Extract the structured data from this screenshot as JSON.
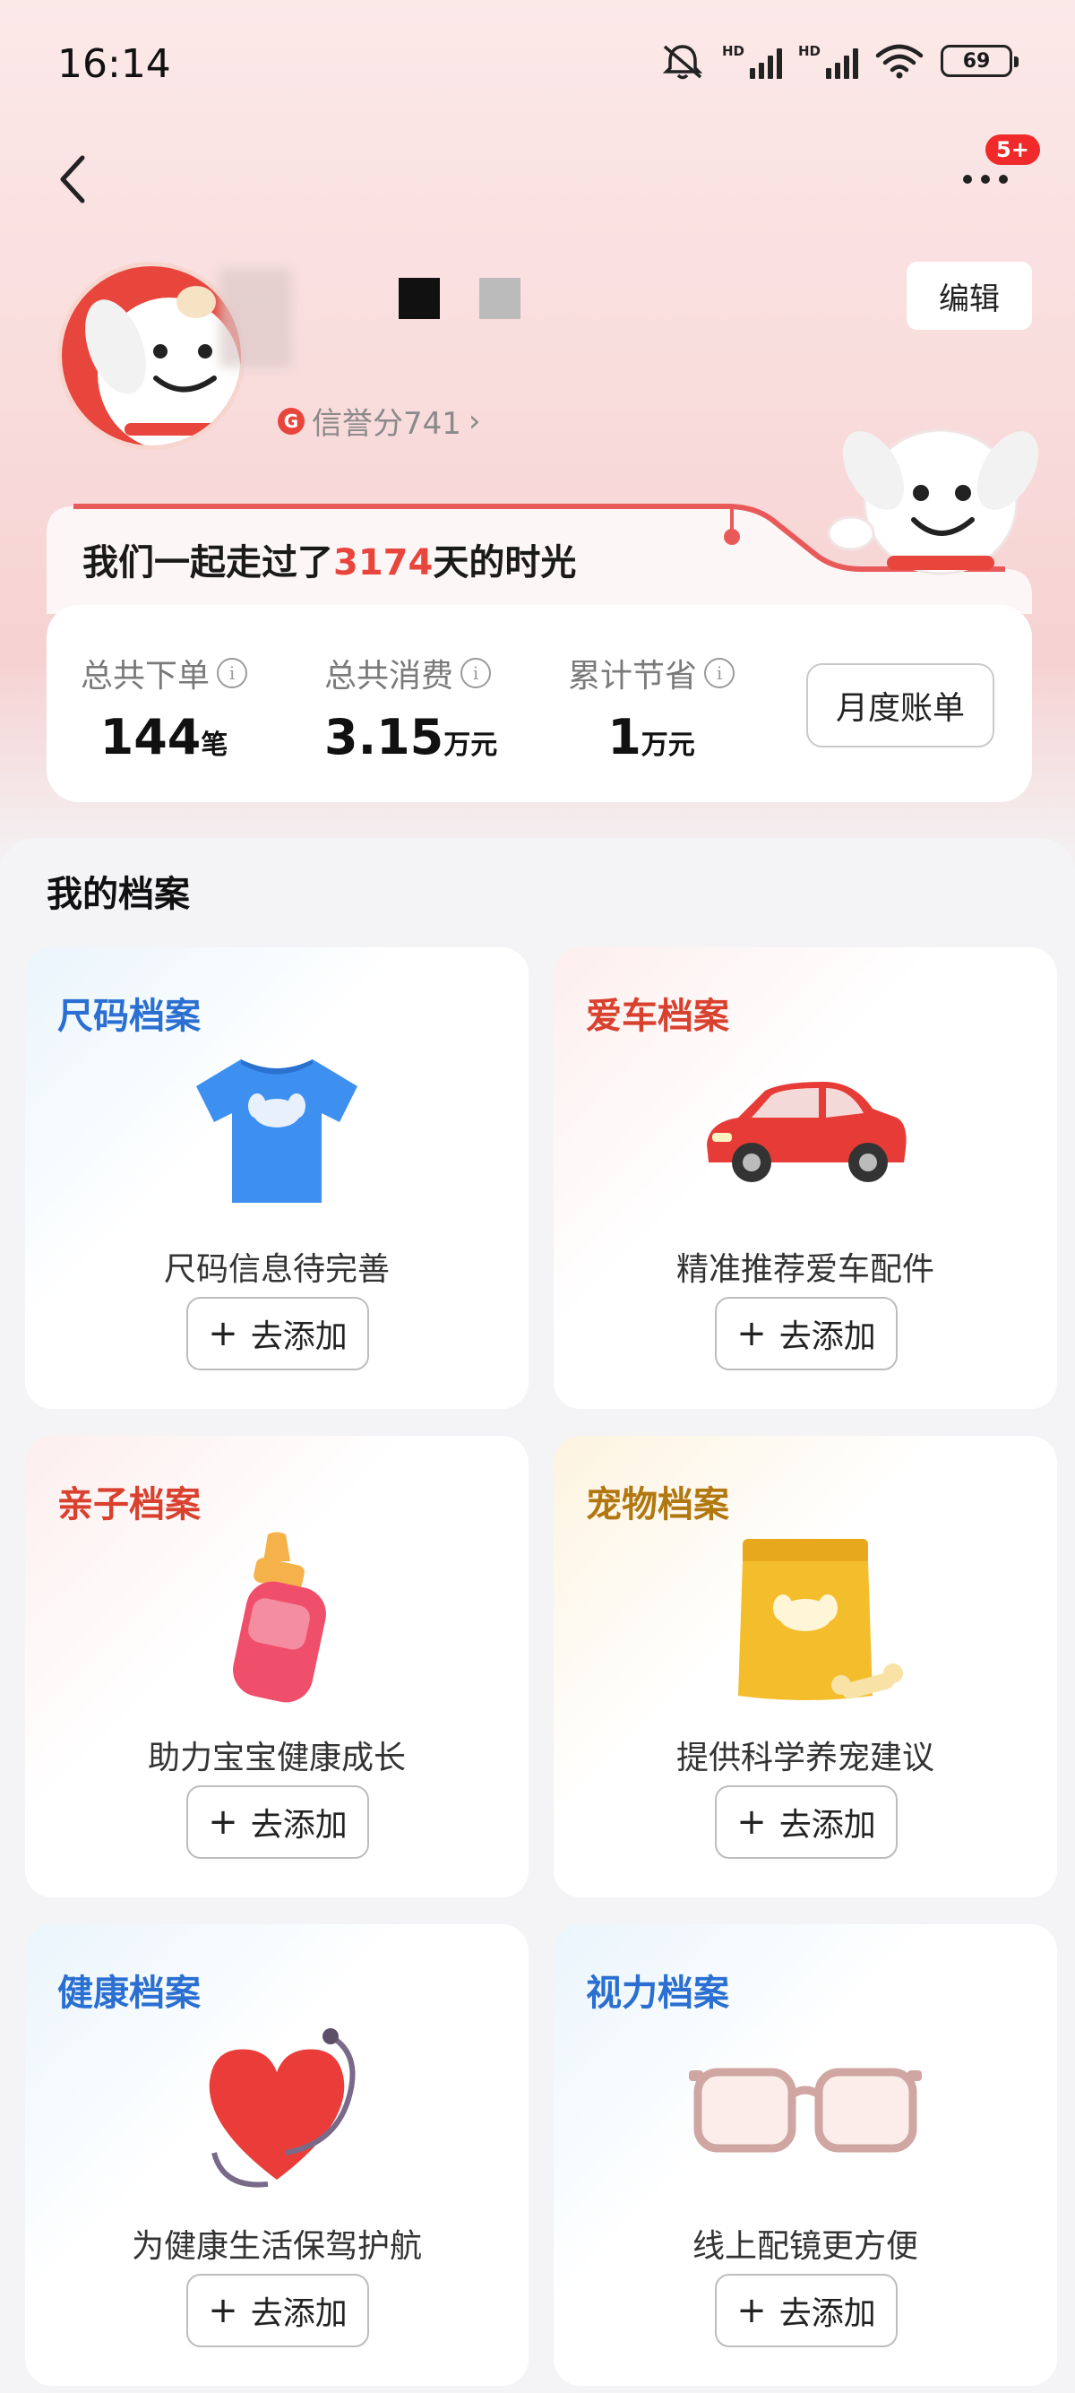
{
  "status_bar": {
    "time": "16:14",
    "battery": "69",
    "hd1": "HD",
    "hd2": "HD"
  },
  "header": {
    "badge": "5+"
  },
  "profile": {
    "credit_label": "信誉分741",
    "credit_icon": "G",
    "edit_label": "编辑"
  },
  "together": {
    "prefix": "我们一起走过了",
    "days": "3174",
    "suffix": "天的时光"
  },
  "stats": [
    {
      "label": "总共下单",
      "value": "144",
      "unit": "笔"
    },
    {
      "label": "总共消费",
      "value": "3.15",
      "unit": "万元"
    },
    {
      "label": "累计节省",
      "value": "1",
      "unit": "万元"
    }
  ],
  "monthly_bill_label": "月度账单",
  "archives": {
    "section_title": "我的档案",
    "add_label": "去添加",
    "cards": [
      {
        "title": "尺码档案",
        "desc": "尺码信息待完善",
        "icon": "tshirt-icon",
        "title_color": "#2a6fd1"
      },
      {
        "title": "爱车档案",
        "desc": "精准推荐爱车配件",
        "icon": "car-icon",
        "title_color": "#d9412f"
      },
      {
        "title": "亲子档案",
        "desc": "助力宝宝健康成长",
        "icon": "baby-bottle-icon",
        "title_color": "#d9412f"
      },
      {
        "title": "宠物档案",
        "desc": "提供科学养宠建议",
        "icon": "pet-food-bag-icon",
        "title_color": "#b27810"
      },
      {
        "title": "健康档案",
        "desc": "为健康生活保驾护航",
        "icon": "heart-stethoscope-icon",
        "title_color": "#2a6fd1"
      },
      {
        "title": "视力档案",
        "desc": "线上配镜更方便",
        "icon": "glasses-icon",
        "title_color": "#2a6fd1"
      }
    ]
  }
}
